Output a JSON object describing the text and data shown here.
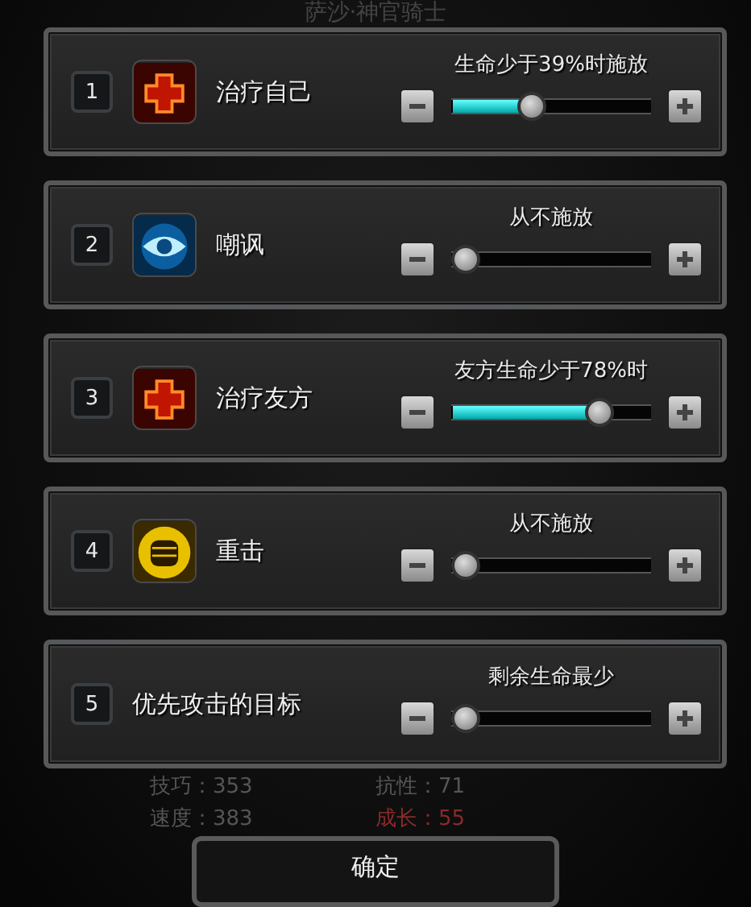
{
  "background": {
    "title": "萨沙·神官骑士",
    "stats": [
      {
        "label": "技巧：353",
        "highlight": false
      },
      {
        "label": "抗性：71",
        "highlight": false
      },
      {
        "label": "速度：383",
        "highlight": false
      },
      {
        "label": "成长：55",
        "highlight": true
      }
    ]
  },
  "rules": [
    {
      "kind": "skill",
      "number": "1",
      "name": "治疗自己",
      "condition": "生命少于39%时施放",
      "level": 0.39
    },
    {
      "kind": "skill",
      "number": "2",
      "name": "嘲讽",
      "condition": "从不施放",
      "level": 0
    },
    {
      "kind": "skill",
      "number": "3",
      "name": "治疗友方",
      "condition": "友方生命少于78%时",
      "level": 0.78
    },
    {
      "kind": "skill",
      "number": "4",
      "name": "重击",
      "condition": "从不施放",
      "level": 0
    },
    {
      "kind": "target",
      "number": "5",
      "name": "优先攻击的目标",
      "condition": "剩余生命最少",
      "level": 0
    }
  ],
  "confirm": {
    "label": "确定"
  }
}
